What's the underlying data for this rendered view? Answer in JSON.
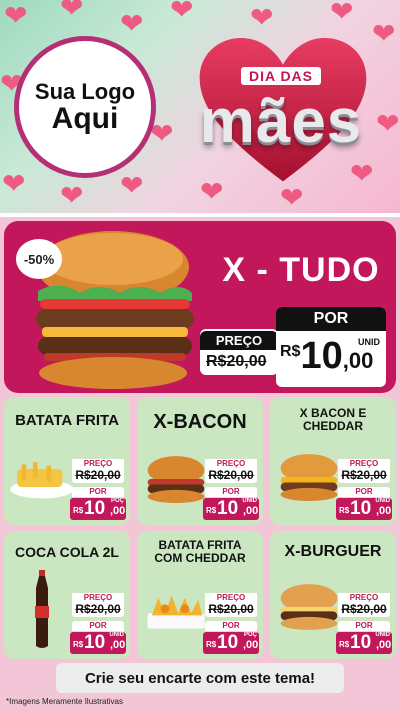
{
  "header": {
    "logo_line1": "Sua Logo",
    "logo_line2": "Aqui",
    "event_top": "DIA DAS",
    "event_main": "mães"
  },
  "featured": {
    "discount": "-50%",
    "name": "X - TUDO",
    "preco_label": "PREÇO",
    "old_price": "R$20,00",
    "por_label": "POR",
    "currency": "R$",
    "price_int": "10",
    "price_cents": ",00",
    "unit": "UNID"
  },
  "products": [
    {
      "name": "BATATA FRITA",
      "preco_label": "PREÇO",
      "old": "R$20,00",
      "por_label": "POR",
      "currency": "R$",
      "int": "10",
      "cents": ",00",
      "unit": "POÇ"
    },
    {
      "name": "X-BACON",
      "preco_label": "PREÇO",
      "old": "R$20,00",
      "por_label": "POR",
      "currency": "R$",
      "int": "10",
      "cents": ",00",
      "unit": "UNID"
    },
    {
      "name": "X BACON E CHEDDAR",
      "preco_label": "PREÇO",
      "old": "R$20,00",
      "por_label": "POR",
      "currency": "R$",
      "int": "10",
      "cents": ",00",
      "unit": "UNID"
    },
    {
      "name": "COCA COLA 2L",
      "preco_label": "PREÇO",
      "old": "R$20,00",
      "por_label": "POR",
      "currency": "R$",
      "int": "10",
      "cents": ",00",
      "unit": "UNID"
    },
    {
      "name": "BATATA FRITA COM CHEDDAR",
      "preco_label": "PREÇO",
      "old": "R$20,00",
      "por_label": "POR",
      "currency": "R$",
      "int": "10",
      "cents": ",00",
      "unit": "POÇ"
    },
    {
      "name": "X-BURGUER",
      "preco_label": "PREÇO",
      "old": "R$20,00",
      "por_label": "POR",
      "currency": "R$",
      "int": "10",
      "cents": ",00",
      "unit": "UNID"
    }
  ],
  "cta": "Crie seu encarte com este tema!",
  "footnote": "*Imagens Meramente Ilustrativas",
  "colors": {
    "brand_pink": "#c2185b",
    "card_green": "#cbe7c2",
    "heart_pink": "#ee5a82"
  }
}
